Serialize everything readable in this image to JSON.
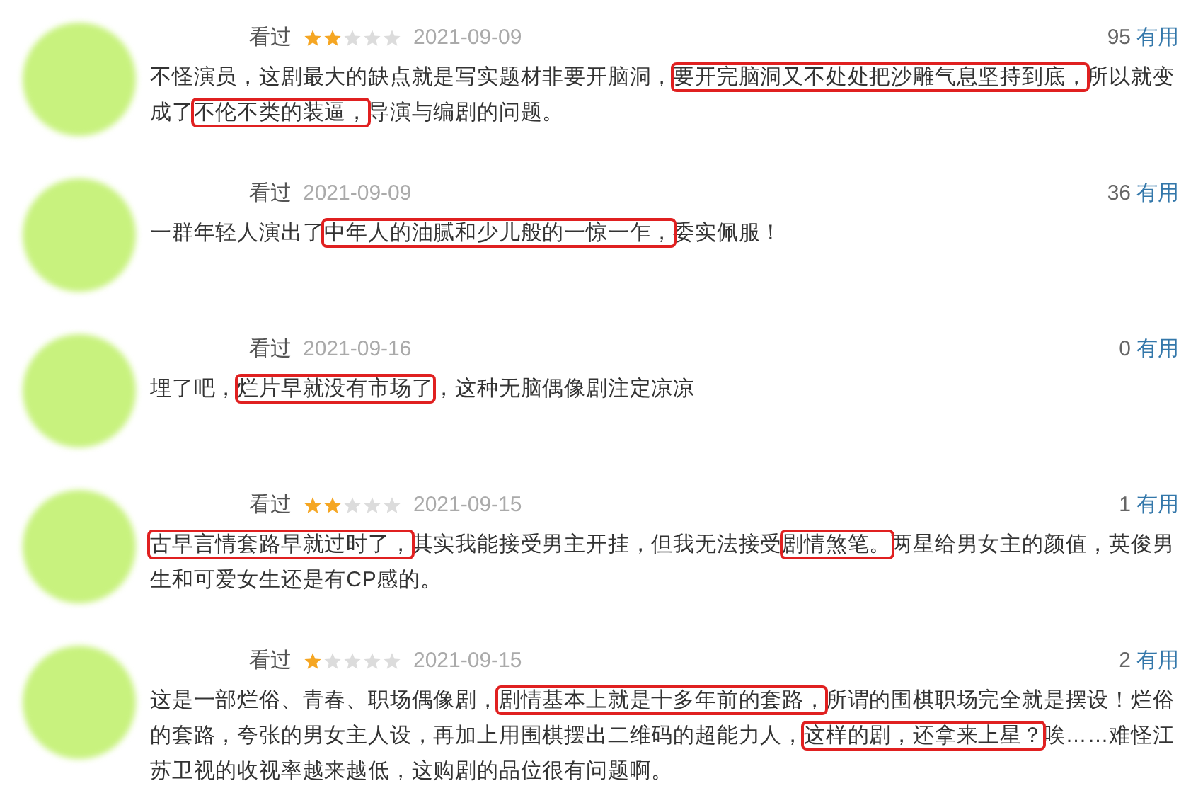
{
  "reviews": [
    {
      "status": "看过",
      "stars": 2,
      "date": "2021-09-09",
      "useful_count": "95",
      "useful_label": "有用",
      "text": [
        {
          "t": "不怪演员，这剧最大的缺点就是写实题材非要开脑洞，",
          "highlighted": false
        },
        {
          "t": "要开完脑洞又不处处把沙雕气息坚持到底，",
          "highlighted": true
        },
        {
          "t": "所以就变成了",
          "highlighted": false
        },
        {
          "t": "不伦不类的装逼，",
          "highlighted": true
        },
        {
          "t": "导演与编剧的问题。",
          "highlighted": false
        }
      ]
    },
    {
      "status": "看过",
      "date": "2021-09-09",
      "useful_count": "36",
      "useful_label": "有用",
      "text": [
        {
          "t": "一群年轻人演出了",
          "highlighted": false
        },
        {
          "t": "中年人的油腻和少儿般的一惊一乍，",
          "highlighted": true
        },
        {
          "t": "委实佩服！",
          "highlighted": false
        }
      ]
    },
    {
      "status": "看过",
      "date": "2021-09-16",
      "useful_count": "0",
      "useful_label": "有用",
      "text": [
        {
          "t": "埋了吧，",
          "highlighted": false
        },
        {
          "t": "烂片早就没有市场了",
          "highlighted": true
        },
        {
          "t": "，这种无脑偶像剧注定凉凉",
          "highlighted": false
        }
      ]
    },
    {
      "status": "看过",
      "stars": 2,
      "date": "2021-09-15",
      "useful_count": "1",
      "useful_label": "有用",
      "text": [
        {
          "t": "古早言情套路早就过时了，",
          "highlighted": true
        },
        {
          "t": "其实我能接受男主开挂，但我无法接受",
          "highlighted": false
        },
        {
          "t": "剧情煞笔。",
          "highlighted": true
        },
        {
          "t": "两星给男女主的颜值，英俊男生和可爱女生还是有CP感的。",
          "highlighted": false
        }
      ]
    },
    {
      "status": "看过",
      "stars": 1,
      "date": "2021-09-15",
      "useful_count": "2",
      "useful_label": "有用",
      "text": [
        {
          "t": "这是一部烂俗、青春、职场偶像剧，",
          "highlighted": false
        },
        {
          "t": "剧情基本上就是十多年前的套路，",
          "highlighted": true
        },
        {
          "t": "所谓的围棋职场完全就是摆设！烂俗的套路，夸张的男女主人设，再加上用围棋摆出二维码的超能力人，",
          "highlighted": false
        },
        {
          "t": "这样的剧，还拿来上星？",
          "highlighted": true
        },
        {
          "t": "唉……难怪江苏卫视的收视率越来越低，这购剧的品位很有问题啊。",
          "highlighted": false
        }
      ]
    }
  ]
}
